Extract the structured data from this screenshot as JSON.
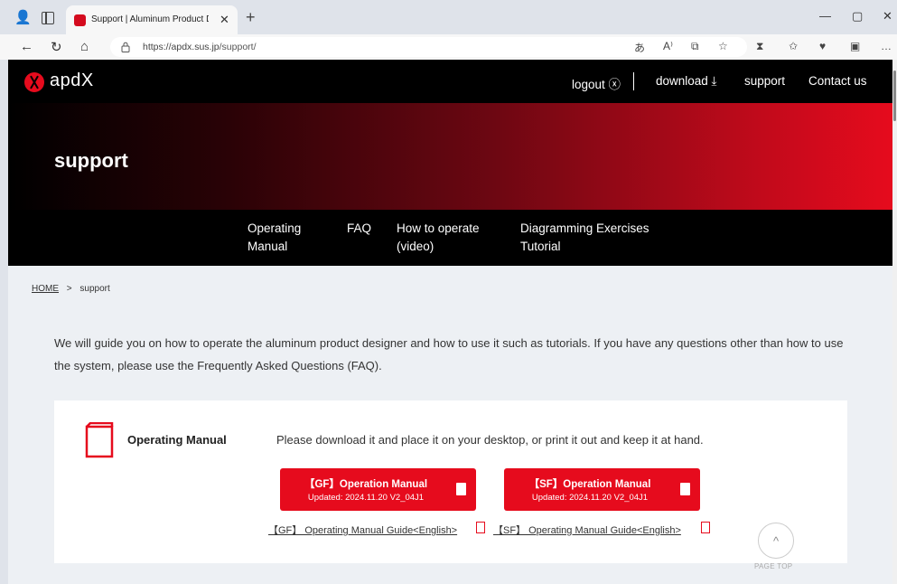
{
  "browser": {
    "tab_title": "Support | Aluminum Product Designer",
    "tab_close": "✕",
    "new_tab": "+",
    "url_host": "https://apdx.sus.jp",
    "url_path": "/support/",
    "window_minimize": "—",
    "window_maximize": "▢",
    "window_close": "✕"
  },
  "header": {
    "logo_text": "apdX",
    "nav": {
      "logout": "logout ⓧ",
      "download": "download ⤓",
      "support": "support",
      "contact": "Contact us"
    }
  },
  "hero": {
    "title": "support"
  },
  "subnav": {
    "items": [
      {
        "line1": "Operating",
        "line2": "Manual"
      },
      {
        "line1": "FAQ",
        "line2": ""
      },
      {
        "line1": "How to operate",
        "line2": "(video)"
      },
      {
        "line1": "Diagramming Exercises",
        "line2": "Tutorial"
      }
    ]
  },
  "breadcrumb": {
    "home": "HOME",
    "sep": ">",
    "current": "support"
  },
  "intro": {
    "text": "We will guide you on how to operate the aluminum product designer and how to use it such as tutorials. If you have any questions other than how to use the system, please use the Frequently Asked Questions (FAQ)."
  },
  "manual_card": {
    "title": "Operating Manual",
    "description": "Please download it and place it on your desktop, or print it out and keep it at hand.",
    "buttons": [
      {
        "title": "【GF】Operation Manual",
        "updated": "Updated: 2024.11.20 V2_04J1"
      },
      {
        "title": "【SF】Operation Manual",
        "updated": "Updated: 2024.11.20 V2_04J1"
      }
    ],
    "guides": [
      {
        "label": "【GF】 Operating Manual Guide<English>"
      },
      {
        "label": "【SF】 Operating Manual Guide<English>"
      }
    ]
  },
  "page_top": {
    "label": "PAGE TOP",
    "arrow": "^"
  },
  "icons": {
    "pdf": "PDF",
    "read_aloud": "A⁾",
    "translate": "あ"
  }
}
